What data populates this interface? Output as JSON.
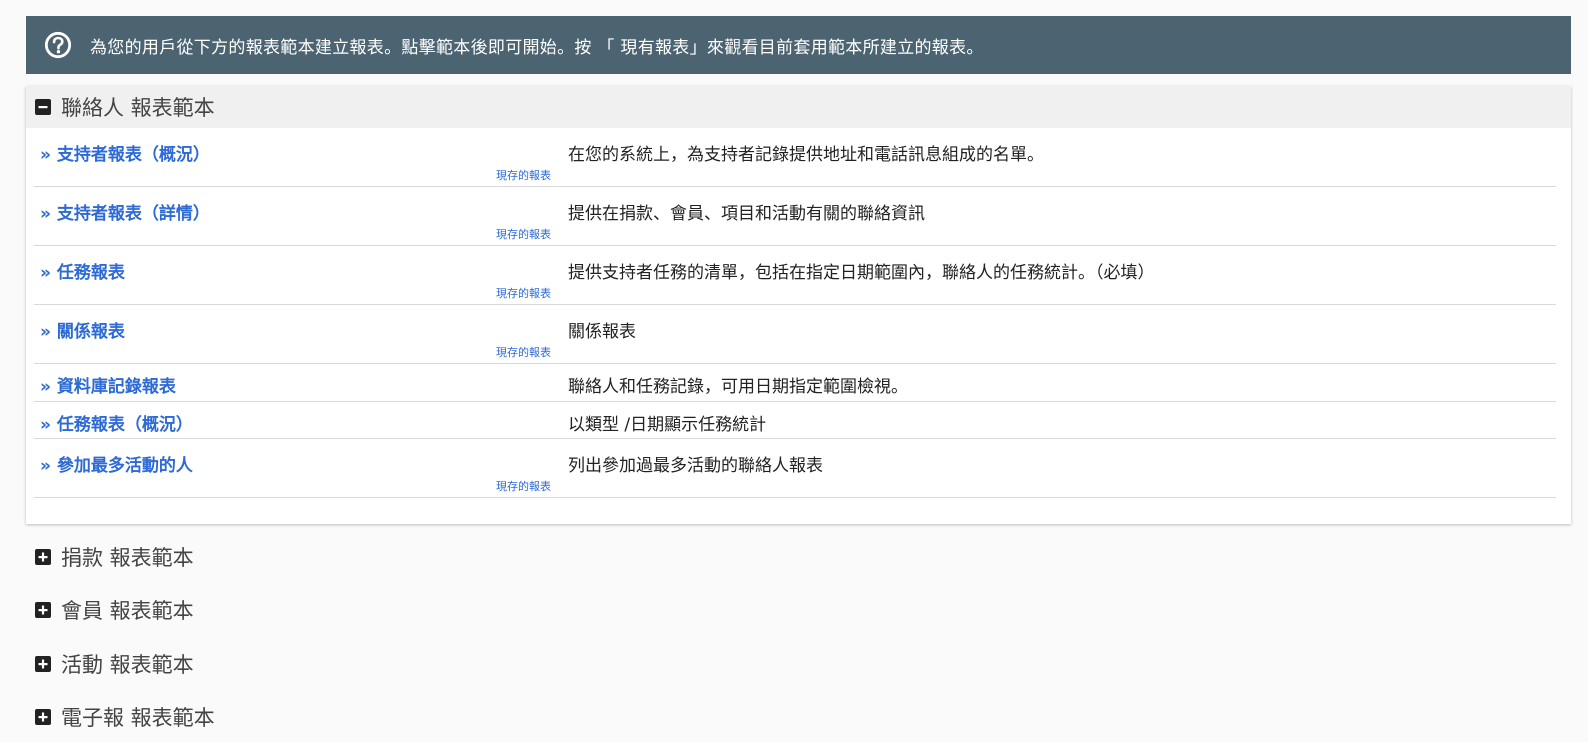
{
  "help_banner": {
    "icon": "question-circle-icon",
    "text": "為您的用戶從下方的報表範本建立報表。點擊範本後即可開始。按 「 現有報表」來觀看目前套用範本所建立的報表。"
  },
  "contacts_section": {
    "title": "聯絡人 報表範本",
    "toggle_icon": "minus-square-icon",
    "rows": [
      {
        "link": "» 支持者報表（概況）",
        "saved": "現存的報表",
        "desc": "在您的系統上，為支持者記錄提供地址和電話訊息組成的名單。"
      },
      {
        "link": "» 支持者報表（詳情）",
        "saved": "現存的報表",
        "desc": "提供在捐款、會員、項目和活動有關的聯絡資訊"
      },
      {
        "link": "» 任務報表",
        "saved": "現存的報表",
        "desc": "提供支持者任務的清單，包括在指定日期範圍內，聯絡人的任務統計。（必填）"
      },
      {
        "link": "» 關係報表",
        "saved": "現存的報表",
        "desc": "關係報表"
      },
      {
        "link": "» 資料庫記錄報表",
        "desc": "聯絡人和任務記錄，可用日期指定範圍檢視。"
      },
      {
        "link": "» 任務報表（概況）",
        "desc": "以類型 /日期顯示任務統計"
      },
      {
        "link": "» 參加最多活動的人",
        "saved": "現存的報表",
        "desc": "列出參加過最多活動的聯絡人報表"
      }
    ]
  },
  "collapsed_sections": [
    {
      "title": "捐款 報表範本",
      "icon": "plus-square-icon"
    },
    {
      "title": "會員 報表範本",
      "icon": "plus-square-icon"
    },
    {
      "title": "活動 報表範本",
      "icon": "plus-square-icon"
    },
    {
      "title": "電子報 報表範本",
      "icon": "plus-square-icon"
    }
  ]
}
